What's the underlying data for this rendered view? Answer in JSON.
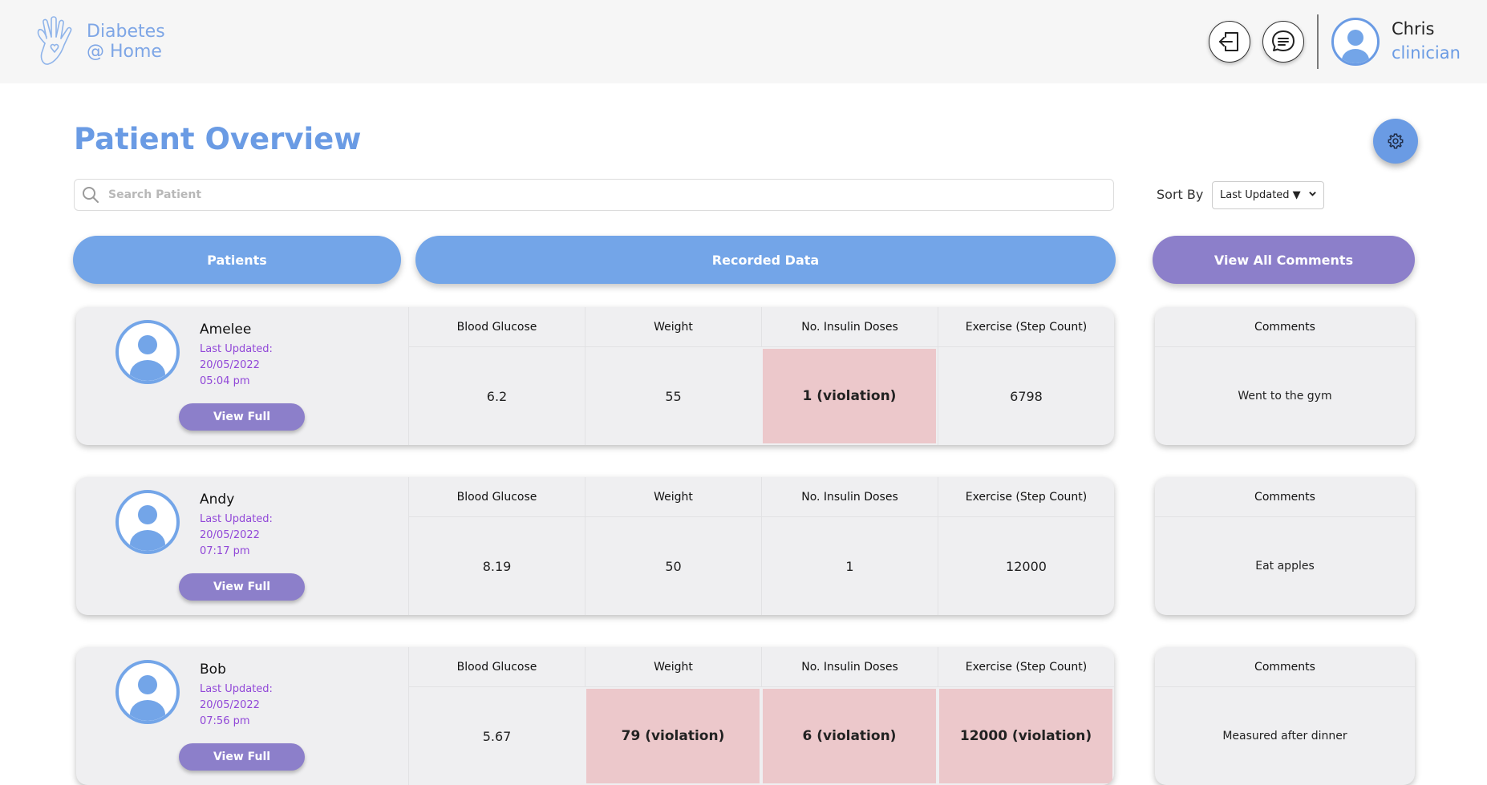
{
  "header": {
    "logo_line1": "Diabetes",
    "logo_line2": "@ Home",
    "user_name": "Chris",
    "user_role": "clinician"
  },
  "page": {
    "title": "Patient Overview"
  },
  "search": {
    "placeholder": "Search Patient"
  },
  "sort": {
    "label": "Sort By",
    "selected": "Last Updated ▼"
  },
  "sections": {
    "patients": "Patients",
    "recorded": "Recorded Data",
    "comments": "View All Comments"
  },
  "columns": [
    "Blood Glucose",
    "Weight",
    "No. Insulin Doses",
    "Exercise (Step Count)"
  ],
  "comments_header": "Comments",
  "view_full_label": "View Full",
  "patients": [
    {
      "name": "Amelee",
      "updated_label": "Last Updated:",
      "date": "20/05/2022",
      "time": "05:04 pm",
      "values": [
        "6.2",
        "55",
        "1 (violation)",
        "6798"
      ],
      "violations": [
        false,
        false,
        true,
        false
      ],
      "comment": "Went to the gym"
    },
    {
      "name": "Andy",
      "updated_label": "Last Updated:",
      "date": "20/05/2022",
      "time": "07:17 pm",
      "values": [
        "8.19",
        "50",
        "1",
        "12000"
      ],
      "violations": [
        false,
        false,
        false,
        false
      ],
      "comment": "Eat apples"
    },
    {
      "name": "Bob",
      "updated_label": "Last Updated:",
      "date": "20/05/2022",
      "time": "07:56 pm",
      "values": [
        "5.67",
        "79 (violation)",
        "6 (violation)",
        "12000 (violation)"
      ],
      "violations": [
        false,
        true,
        true,
        true
      ],
      "comment": "Measured after dinner"
    }
  ],
  "colors": {
    "primary": "#73a5e8",
    "accent": "#8c7fca",
    "violation": "#ecc8cb",
    "date_text": "#9147d8"
  }
}
